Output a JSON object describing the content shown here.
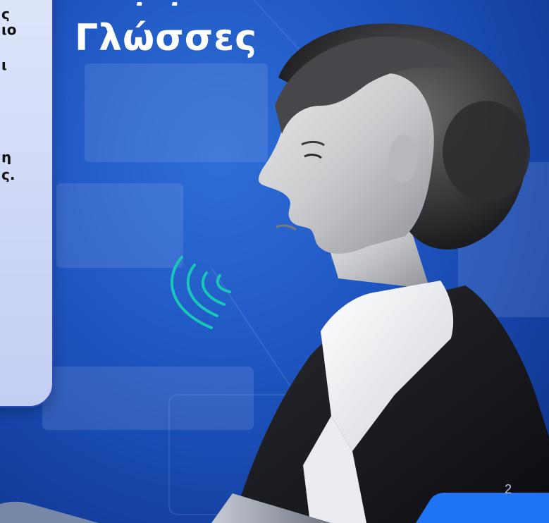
{
  "slide": {
    "title": "Γλώσσες",
    "page_number": "2"
  },
  "card": {
    "lines": [
      "ς",
      "ιο",
      "ι",
      "η",
      "ς."
    ]
  },
  "colors": {
    "background": "#1f56c2",
    "card": "#cdd7f6",
    "card_border": "#2a4fb8",
    "sound_waves": "#18c7b8",
    "accent_corner": "#1e74f2"
  },
  "icons": {
    "sound_waves": "sound-waves-icon"
  }
}
